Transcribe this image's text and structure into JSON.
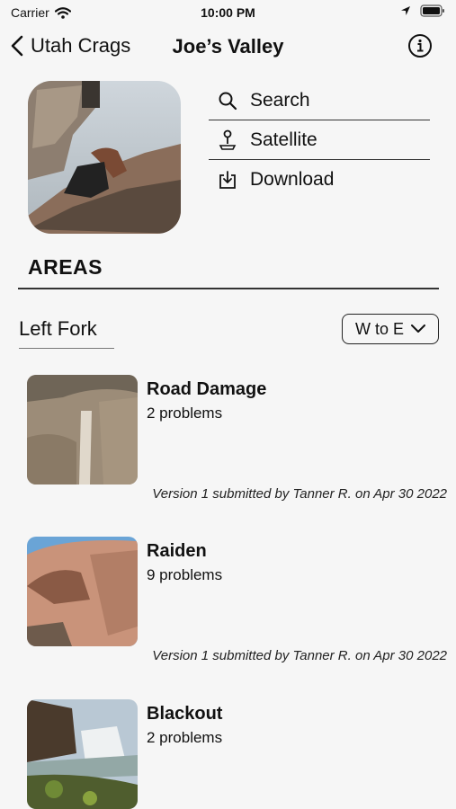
{
  "status_bar": {
    "carrier": "Carrier",
    "time": "10:00 PM",
    "icons": [
      "wifi-icon",
      "location-arrow-icon",
      "battery-icon"
    ]
  },
  "nav": {
    "back_label": "Utah Crags",
    "title": "Joe’s Valley",
    "icons": [
      "chevron-left-icon",
      "info-icon"
    ]
  },
  "header": {
    "image": "boulderer-climbing-photo",
    "menu": [
      {
        "label": "Search",
        "icon": "search-icon"
      },
      {
        "label": "Satellite",
        "icon": "map-pin-icon"
      },
      {
        "label": "Download",
        "icon": "download-icon"
      }
    ]
  },
  "areas": {
    "title": "AREAS",
    "section": "Left Fork",
    "sort_label": "W to E",
    "items": [
      {
        "name": "Road Damage",
        "problems": "2 problems",
        "version": "Version 1 submitted by Tanner R. on Apr 30 2022",
        "image": "rock-wall-photo"
      },
      {
        "name": "Raiden",
        "problems": "9 problems",
        "version": "Version 1 submitted by Tanner R. on Apr 30 2022",
        "image": "boulder-arch-photo"
      },
      {
        "name": "Blackout",
        "problems": "2 problems",
        "image": "waterfall-photo"
      }
    ]
  },
  "colors": {
    "background": "#f6f6f6",
    "text": "#111111",
    "rule": "#333333"
  }
}
